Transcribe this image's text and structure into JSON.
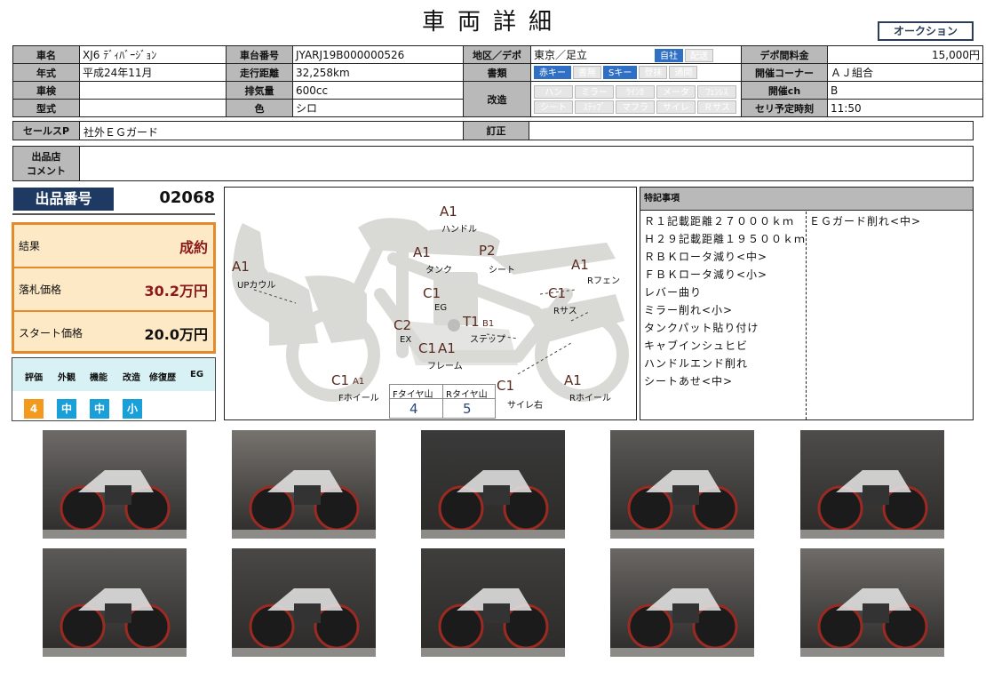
{
  "page": {
    "title": "車両詳細",
    "auction_tag": "オークション"
  },
  "spec": {
    "labels": {
      "name": "車名",
      "frame": "車台番号",
      "area": "地区／デポ",
      "depo_fee": "デポ間料金",
      "year": "年式",
      "mileage": "走行距離",
      "docs": "書類",
      "corner": "開催コーナー",
      "inspection": "車検",
      "displacement": "排気量",
      "modified": "改造",
      "channel": "開催ch",
      "model": "型式",
      "color": "色",
      "slot_time": "セリ予定時刻"
    },
    "values": {
      "name": "XJ6 ﾃﾞｨﾊﾞｰｼﾞｮﾝ",
      "frame": "JYARJ19B000000526",
      "area": "東京／足立",
      "depo_fee": "15,000円",
      "year": "平成24年11月",
      "mileage": "32,258km",
      "corner": "ＡＪ組合",
      "inspection": "",
      "displacement": "600cc",
      "channel": "B",
      "model": "",
      "color": "シロ",
      "slot_time": "11:50"
    },
    "area_buttons": [
      {
        "label": "自社",
        "on": true
      },
      {
        "label": "配送",
        "on": false
      }
    ],
    "doc_buttons": [
      {
        "label": "赤キー",
        "on": true
      },
      {
        "label": "書無",
        "on": false
      },
      {
        "label": "Sキー",
        "on": true
      },
      {
        "label": "登抹",
        "on": false
      },
      {
        "label": "通関",
        "on": false
      }
    ],
    "mod_row1": [
      "ハン",
      "ミラー",
      "ｳｲﾝｶ",
      "メータ",
      "ﾌｪﾝﾚｽ"
    ],
    "mod_row2": [
      "シート",
      "ｽﾃｯﾌﾟ",
      "マフラ",
      "サイレ",
      "Ｒサス"
    ]
  },
  "sales": {
    "label": "セールスP",
    "value": "社外ＥＧガード",
    "correction_label": "訂正",
    "correction_value": ""
  },
  "comment": {
    "label1": "出品店",
    "label2": "コメント",
    "value": ""
  },
  "lot": {
    "label": "出品番号",
    "number": "02068"
  },
  "prices": [
    {
      "label": "結果",
      "value": "成約",
      "color": "#8b1a1a"
    },
    {
      "label": "落札価格",
      "value": "30.2万円",
      "color": "#8b1a1a"
    },
    {
      "label": "スタート価格",
      "value": "20.0万円",
      "color": "#111111"
    }
  ],
  "evaluation": {
    "headers": [
      "評価",
      "外観",
      "機能",
      "改造",
      "修復歴",
      "EG"
    ],
    "chips": [
      {
        "value": "4",
        "color": "#f39a1e"
      },
      {
        "value": "中",
        "color": "#1aa0d8"
      },
      {
        "value": "中",
        "color": "#1aa0d8"
      },
      {
        "value": "小",
        "color": "#1aa0d8"
      }
    ]
  },
  "diagram": {
    "parts": {
      "handle": "ハンドル",
      "tank": "タンク",
      "seat": "シート",
      "rfender": "Rフェン",
      "upcowl": "UPカウル",
      "eg": "EG",
      "rsus": "Rサス",
      "ex": "EX",
      "step": "ステップ",
      "frame": "フレーム",
      "fwheel": "Fホイール",
      "silencer": "サイレ右",
      "rwheel": "Rホイール"
    },
    "codes": {
      "handle": "A1",
      "tank": "A1",
      "seat": "P2",
      "rfender": "A1",
      "upcowl": "A1",
      "eg": "C1",
      "rsus": "C1",
      "ex": "C2",
      "step": "T1",
      "step_small": "B1",
      "frame1": "C1",
      "frame2": "A1",
      "fwheel": "C1",
      "fwheel_small": "A1",
      "silencer": "C1",
      "rwheel": "A1"
    },
    "tyres": {
      "f_label": "Fタイヤ山",
      "r_label": "Rタイヤ山",
      "f_value": "4",
      "r_value": "5"
    }
  },
  "notes": {
    "header": "特記事項",
    "col1": [
      "Ｒ１記載距離２７０００ｋｍ",
      "Ｈ２９記載距離１９５００ｋｍ",
      "ＲＢＫロータ減り<中>",
      "ＦＢＫロータ減り<小>",
      "レバー曲り",
      "ミラー削れ<小>",
      "タンクパット貼り付け",
      "キャブインシュヒビ",
      "ハンドルエンド削れ",
      "シートあせ<中>"
    ],
    "col2": [
      "ＥＧガード削れ<中>"
    ]
  },
  "photos": [
    {
      "name": "photo-left-side",
      "bg": "#6d6a68"
    },
    {
      "name": "photo-right-side",
      "bg": "#77736f"
    },
    {
      "name": "photo-meter",
      "bg": "#3a3a3a"
    },
    {
      "name": "photo-seat",
      "bg": "#5a5956"
    },
    {
      "name": "photo-front-wheel",
      "bg": "#4e4c4a"
    },
    {
      "name": "photo-front-fork",
      "bg": "#5b5a58"
    },
    {
      "name": "photo-rear-wheel",
      "bg": "#4a4846"
    },
    {
      "name": "photo-muffler",
      "bg": "#3f3e3c"
    },
    {
      "name": "photo-front",
      "bg": "#6a6764"
    },
    {
      "name": "photo-rear",
      "bg": "#6f6c69"
    }
  ]
}
